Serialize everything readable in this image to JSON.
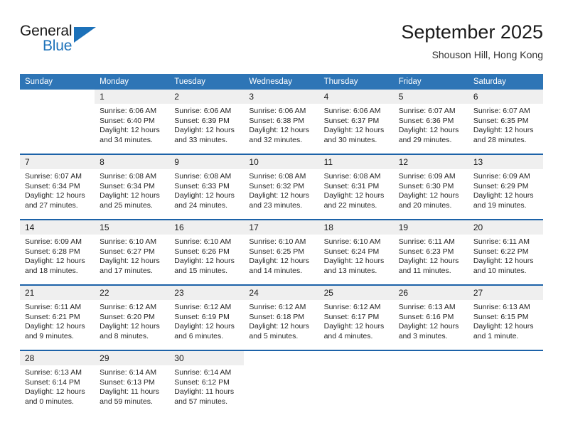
{
  "brand": {
    "name_part1": "General",
    "name_part2": "Blue",
    "flag_icon": "blue-triangle-flag-icon"
  },
  "header": {
    "month_title": "September 2025",
    "location": "Shouson Hill, Hong Kong"
  },
  "colors": {
    "header_blue": "#2e75b6",
    "separator_blue": "#1c62a8",
    "daynum_band": "#efefef",
    "brand_blue": "#1c71b9",
    "text": "#1a1a1a"
  },
  "weekday_headers": [
    "Sunday",
    "Monday",
    "Tuesday",
    "Wednesday",
    "Thursday",
    "Friday",
    "Saturday"
  ],
  "weeks": [
    {
      "days": [
        {
          "num": "",
          "sunrise": "",
          "sunset": "",
          "daylight1": "",
          "daylight2": "",
          "empty": true
        },
        {
          "num": "1",
          "sunrise": "Sunrise: 6:06 AM",
          "sunset": "Sunset: 6:40 PM",
          "daylight1": "Daylight: 12 hours",
          "daylight2": "and 34 minutes.",
          "empty": false
        },
        {
          "num": "2",
          "sunrise": "Sunrise: 6:06 AM",
          "sunset": "Sunset: 6:39 PM",
          "daylight1": "Daylight: 12 hours",
          "daylight2": "and 33 minutes.",
          "empty": false
        },
        {
          "num": "3",
          "sunrise": "Sunrise: 6:06 AM",
          "sunset": "Sunset: 6:38 PM",
          "daylight1": "Daylight: 12 hours",
          "daylight2": "and 32 minutes.",
          "empty": false
        },
        {
          "num": "4",
          "sunrise": "Sunrise: 6:06 AM",
          "sunset": "Sunset: 6:37 PM",
          "daylight1": "Daylight: 12 hours",
          "daylight2": "and 30 minutes.",
          "empty": false
        },
        {
          "num": "5",
          "sunrise": "Sunrise: 6:07 AM",
          "sunset": "Sunset: 6:36 PM",
          "daylight1": "Daylight: 12 hours",
          "daylight2": "and 29 minutes.",
          "empty": false
        },
        {
          "num": "6",
          "sunrise": "Sunrise: 6:07 AM",
          "sunset": "Sunset: 6:35 PM",
          "daylight1": "Daylight: 12 hours",
          "daylight2": "and 28 minutes.",
          "empty": false
        }
      ]
    },
    {
      "days": [
        {
          "num": "7",
          "sunrise": "Sunrise: 6:07 AM",
          "sunset": "Sunset: 6:34 PM",
          "daylight1": "Daylight: 12 hours",
          "daylight2": "and 27 minutes.",
          "empty": false
        },
        {
          "num": "8",
          "sunrise": "Sunrise: 6:08 AM",
          "sunset": "Sunset: 6:34 PM",
          "daylight1": "Daylight: 12 hours",
          "daylight2": "and 25 minutes.",
          "empty": false
        },
        {
          "num": "9",
          "sunrise": "Sunrise: 6:08 AM",
          "sunset": "Sunset: 6:33 PM",
          "daylight1": "Daylight: 12 hours",
          "daylight2": "and 24 minutes.",
          "empty": false
        },
        {
          "num": "10",
          "sunrise": "Sunrise: 6:08 AM",
          "sunset": "Sunset: 6:32 PM",
          "daylight1": "Daylight: 12 hours",
          "daylight2": "and 23 minutes.",
          "empty": false
        },
        {
          "num": "11",
          "sunrise": "Sunrise: 6:08 AM",
          "sunset": "Sunset: 6:31 PM",
          "daylight1": "Daylight: 12 hours",
          "daylight2": "and 22 minutes.",
          "empty": false
        },
        {
          "num": "12",
          "sunrise": "Sunrise: 6:09 AM",
          "sunset": "Sunset: 6:30 PM",
          "daylight1": "Daylight: 12 hours",
          "daylight2": "and 20 minutes.",
          "empty": false
        },
        {
          "num": "13",
          "sunrise": "Sunrise: 6:09 AM",
          "sunset": "Sunset: 6:29 PM",
          "daylight1": "Daylight: 12 hours",
          "daylight2": "and 19 minutes.",
          "empty": false
        }
      ]
    },
    {
      "days": [
        {
          "num": "14",
          "sunrise": "Sunrise: 6:09 AM",
          "sunset": "Sunset: 6:28 PM",
          "daylight1": "Daylight: 12 hours",
          "daylight2": "and 18 minutes.",
          "empty": false
        },
        {
          "num": "15",
          "sunrise": "Sunrise: 6:10 AM",
          "sunset": "Sunset: 6:27 PM",
          "daylight1": "Daylight: 12 hours",
          "daylight2": "and 17 minutes.",
          "empty": false
        },
        {
          "num": "16",
          "sunrise": "Sunrise: 6:10 AM",
          "sunset": "Sunset: 6:26 PM",
          "daylight1": "Daylight: 12 hours",
          "daylight2": "and 15 minutes.",
          "empty": false
        },
        {
          "num": "17",
          "sunrise": "Sunrise: 6:10 AM",
          "sunset": "Sunset: 6:25 PM",
          "daylight1": "Daylight: 12 hours",
          "daylight2": "and 14 minutes.",
          "empty": false
        },
        {
          "num": "18",
          "sunrise": "Sunrise: 6:10 AM",
          "sunset": "Sunset: 6:24 PM",
          "daylight1": "Daylight: 12 hours",
          "daylight2": "and 13 minutes.",
          "empty": false
        },
        {
          "num": "19",
          "sunrise": "Sunrise: 6:11 AM",
          "sunset": "Sunset: 6:23 PM",
          "daylight1": "Daylight: 12 hours",
          "daylight2": "and 11 minutes.",
          "empty": false
        },
        {
          "num": "20",
          "sunrise": "Sunrise: 6:11 AM",
          "sunset": "Sunset: 6:22 PM",
          "daylight1": "Daylight: 12 hours",
          "daylight2": "and 10 minutes.",
          "empty": false
        }
      ]
    },
    {
      "days": [
        {
          "num": "21",
          "sunrise": "Sunrise: 6:11 AM",
          "sunset": "Sunset: 6:21 PM",
          "daylight1": "Daylight: 12 hours",
          "daylight2": "and 9 minutes.",
          "empty": false
        },
        {
          "num": "22",
          "sunrise": "Sunrise: 6:12 AM",
          "sunset": "Sunset: 6:20 PM",
          "daylight1": "Daylight: 12 hours",
          "daylight2": "and 8 minutes.",
          "empty": false
        },
        {
          "num": "23",
          "sunrise": "Sunrise: 6:12 AM",
          "sunset": "Sunset: 6:19 PM",
          "daylight1": "Daylight: 12 hours",
          "daylight2": "and 6 minutes.",
          "empty": false
        },
        {
          "num": "24",
          "sunrise": "Sunrise: 6:12 AM",
          "sunset": "Sunset: 6:18 PM",
          "daylight1": "Daylight: 12 hours",
          "daylight2": "and 5 minutes.",
          "empty": false
        },
        {
          "num": "25",
          "sunrise": "Sunrise: 6:12 AM",
          "sunset": "Sunset: 6:17 PM",
          "daylight1": "Daylight: 12 hours",
          "daylight2": "and 4 minutes.",
          "empty": false
        },
        {
          "num": "26",
          "sunrise": "Sunrise: 6:13 AM",
          "sunset": "Sunset: 6:16 PM",
          "daylight1": "Daylight: 12 hours",
          "daylight2": "and 3 minutes.",
          "empty": false
        },
        {
          "num": "27",
          "sunrise": "Sunrise: 6:13 AM",
          "sunset": "Sunset: 6:15 PM",
          "daylight1": "Daylight: 12 hours",
          "daylight2": "and 1 minute.",
          "empty": false
        }
      ]
    },
    {
      "days": [
        {
          "num": "28",
          "sunrise": "Sunrise: 6:13 AM",
          "sunset": "Sunset: 6:14 PM",
          "daylight1": "Daylight: 12 hours",
          "daylight2": "and 0 minutes.",
          "empty": false
        },
        {
          "num": "29",
          "sunrise": "Sunrise: 6:14 AM",
          "sunset": "Sunset: 6:13 PM",
          "daylight1": "Daylight: 11 hours",
          "daylight2": "and 59 minutes.",
          "empty": false
        },
        {
          "num": "30",
          "sunrise": "Sunrise: 6:14 AM",
          "sunset": "Sunset: 6:12 PM",
          "daylight1": "Daylight: 11 hours",
          "daylight2": "and 57 minutes.",
          "empty": false
        },
        {
          "num": "",
          "sunrise": "",
          "sunset": "",
          "daylight1": "",
          "daylight2": "",
          "empty": true
        },
        {
          "num": "",
          "sunrise": "",
          "sunset": "",
          "daylight1": "",
          "daylight2": "",
          "empty": true
        },
        {
          "num": "",
          "sunrise": "",
          "sunset": "",
          "daylight1": "",
          "daylight2": "",
          "empty": true
        },
        {
          "num": "",
          "sunrise": "",
          "sunset": "",
          "daylight1": "",
          "daylight2": "",
          "empty": true
        }
      ]
    }
  ]
}
